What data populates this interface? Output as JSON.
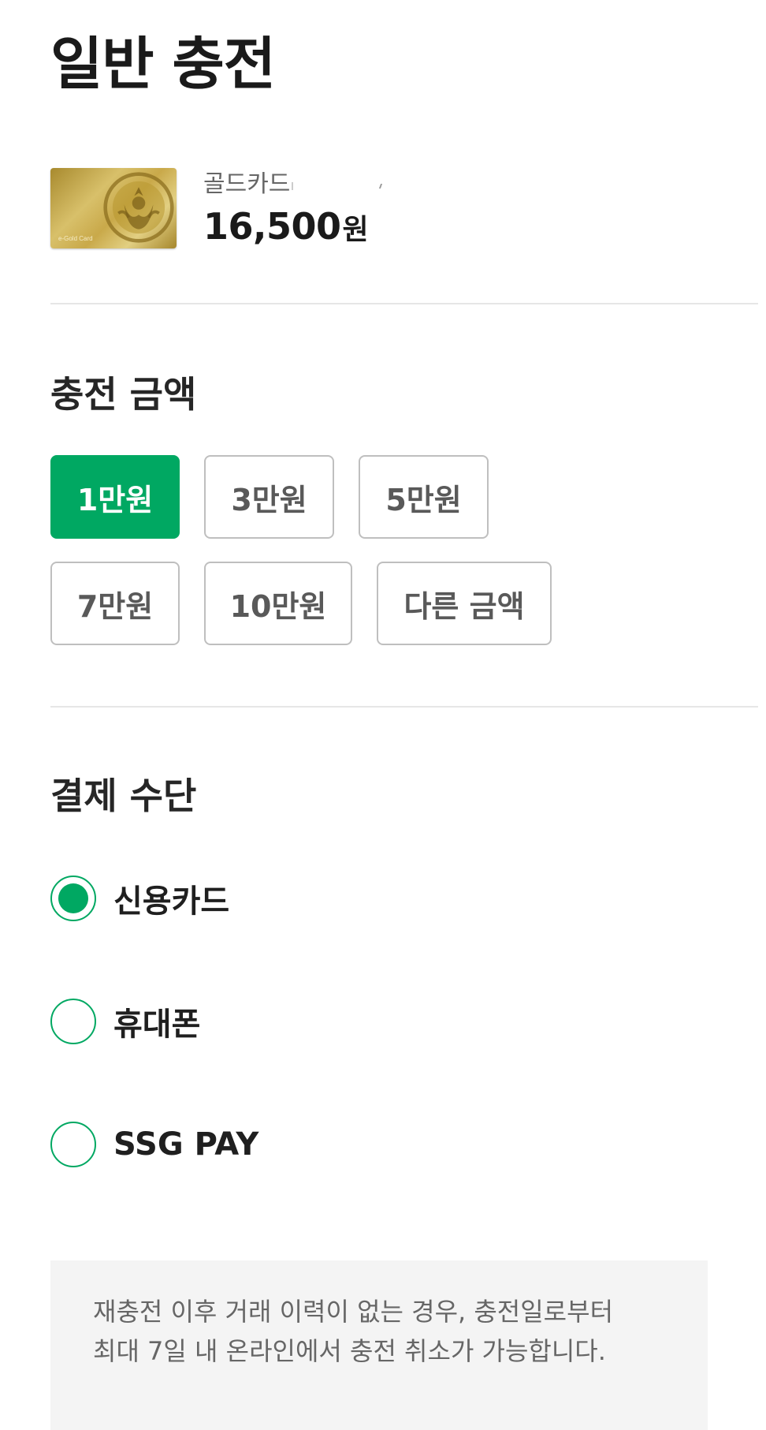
{
  "page": {
    "title": "일반 충전"
  },
  "card": {
    "name": "골드카드",
    "card_logo_text": "e-Gold Card",
    "balance": "16,500",
    "balance_unit": "원"
  },
  "amount_section": {
    "title": "충전 금액",
    "options": [
      {
        "label": "1만원",
        "selected": true
      },
      {
        "label": "3만원",
        "selected": false
      },
      {
        "label": "5만원",
        "selected": false
      },
      {
        "label": "7만원",
        "selected": false
      },
      {
        "label": "10만원",
        "selected": false
      },
      {
        "label": "다른 금액",
        "selected": false
      }
    ]
  },
  "payment_section": {
    "title": "결제 수단",
    "methods": [
      {
        "label": "신용카드",
        "selected": true
      },
      {
        "label": "휴대폰",
        "selected": false
      },
      {
        "label": "SSG PAY",
        "selected": false
      }
    ]
  },
  "notice": {
    "line1": "재충전 이후 거래 이력이 없는 경우, 충전일로부터",
    "line2": "최대 7일 내 온라인에서 충전 취소가 가능합니다."
  },
  "colors": {
    "accent": "#00a862",
    "text_primary": "#1a1a1a",
    "text_secondary": "#666666",
    "border": "#bfbfbf",
    "notice_bg": "#f4f4f4"
  },
  "icons": {
    "card_emblem": "siren-logo-icon"
  }
}
